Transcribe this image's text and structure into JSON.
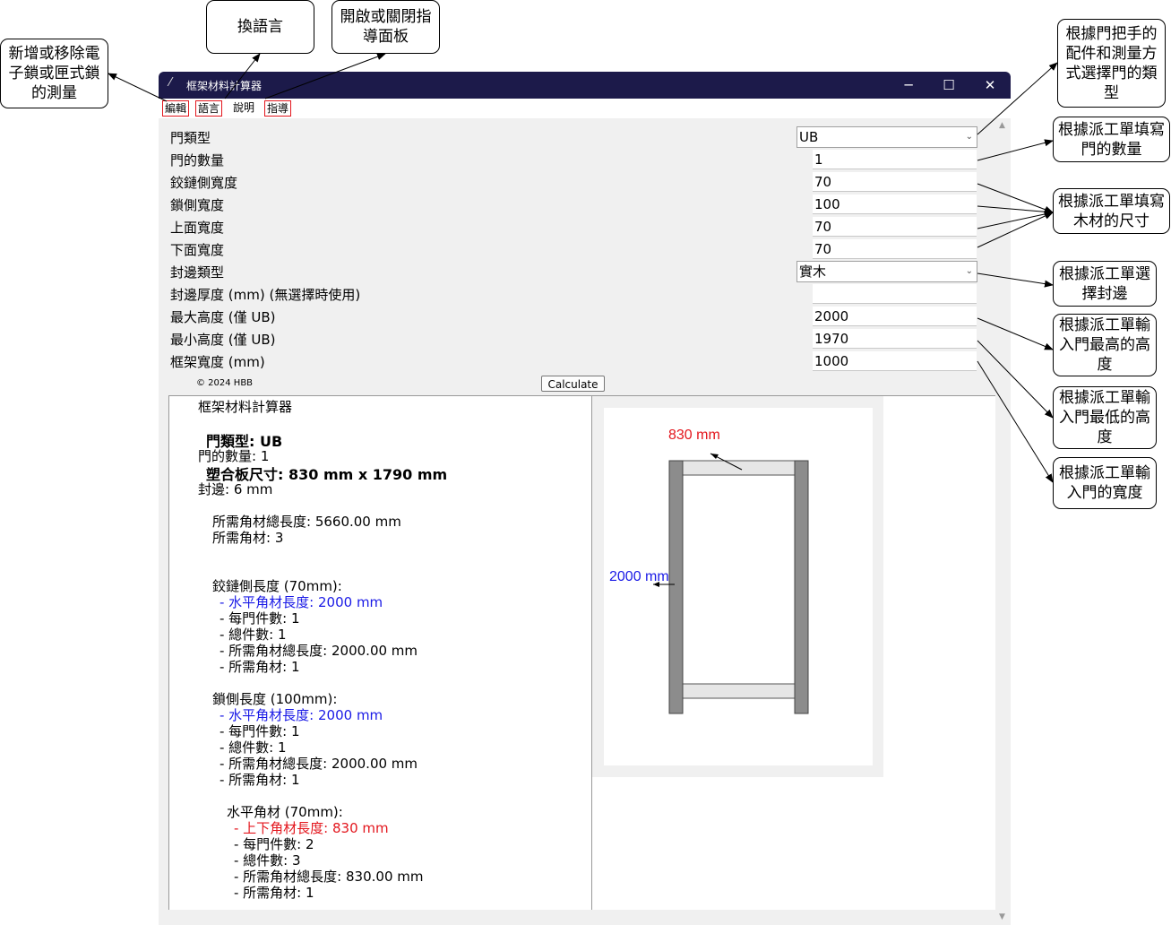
{
  "window": {
    "title": "框架材料計算器",
    "controls": {
      "minimize": "─",
      "maximize": "☐",
      "close": "✕"
    }
  },
  "menu": {
    "edit": "編輯",
    "language": "語言",
    "help": "說明",
    "guide": "指導"
  },
  "form": {
    "fields": [
      {
        "label": "門類型",
        "value": "UB",
        "type": "combo"
      },
      {
        "label": "門的數量",
        "value": "1",
        "type": "entry"
      },
      {
        "label": "鉸鏈側寬度",
        "value": "70",
        "type": "entry"
      },
      {
        "label": "鎖側寬度",
        "value": "100",
        "type": "entry"
      },
      {
        "label": "上面寬度",
        "value": "70",
        "type": "entry"
      },
      {
        "label": "下面寬度",
        "value": "70",
        "type": "entry"
      },
      {
        "label": "封邊類型",
        "value": "實木",
        "type": "combo"
      },
      {
        "label": "封邊厚度 (mm) (無選擇時使用)",
        "value": "",
        "type": "entry"
      },
      {
        "label": "最大高度 (僅 UB)",
        "value": "2000",
        "type": "entry"
      },
      {
        "label": "最小高度 (僅 UB)",
        "value": "1970",
        "type": "entry"
      },
      {
        "label": "框架寬度 (mm)",
        "value": "1000",
        "type": "entry"
      }
    ],
    "copyright": "© 2024 HBB",
    "calculate": "Calculate"
  },
  "output": {
    "title": "框架材料計算器",
    "door_type": "門類型: UB",
    "door_count": "門的數量: 1",
    "board_size": "塑合板尺寸: 830 mm x 1790 mm",
    "edge": "封邊: 6 mm",
    "total_length": "所需角材總長度: 5660.00 mm",
    "total_pieces": "所需角材: 3",
    "hinge": {
      "heading": "鉸鏈側長度 (70mm):",
      "length": "- 水平角材長度: 2000 mm",
      "per_door": "- 每門件數: 1",
      "total": "- 總件數: 1",
      "total_length": "- 所需角材總長度: 2000.00 mm",
      "needed": "- 所需角材: 1"
    },
    "lock": {
      "heading": "鎖側長度 (100mm):",
      "length": "- 水平角材長度: 2000 mm",
      "per_door": "- 每門件數: 1",
      "total": "- 總件數: 1",
      "total_length": "- 所需角材總長度: 2000.00 mm",
      "needed": "- 所需角材: 1"
    },
    "horizontal": {
      "heading": "水平角材 (70mm):",
      "length": "- 上下角材長度: 830 mm",
      "per_door": "- 每門件數: 2",
      "total": "- 總件數: 3",
      "total_length": "- 所需角材總長度: 830.00 mm",
      "needed": "- 所需角材: 1"
    }
  },
  "diagram": {
    "width_label": "830 mm",
    "height_label": "2000 mm",
    "width_color": "#e3161d",
    "height_color": "#1a1ae6"
  },
  "callouts": {
    "edit": "新增或移除電子鎖或匣式鎖的測量",
    "language": "換語言",
    "guide": "開啟或關閉指導面板",
    "door_type": "根據門把手的配件和測量方式選擇門的類型",
    "door_count": "根據派工單填寫門的數量",
    "wood_size": "根據派工單填寫木材的尺寸",
    "edge_type": "根據派工單選擇封邊",
    "max_height": "根據派工單輸入門最高的高度",
    "min_height": "根據派工單輸入門最低的高度",
    "width": "根據派工單輸入門的寬度"
  }
}
